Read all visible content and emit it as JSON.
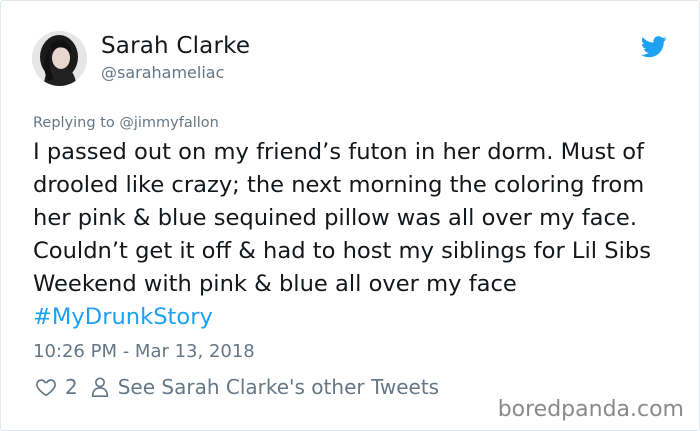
{
  "tweet": {
    "display_name": "Sarah Clarke",
    "handle": "@sarahameliac",
    "replying_prefix": "Replying to",
    "replying_to": "@jimmyfallon",
    "text": "I passed out on my friend’s futon in her dorm. Must of drooled like crazy; the next morning the coloring from her pink & blue sequined pillow was all over my face. Couldn’t get it off & had to host my siblings for Lil Sibs Weekend with pink & blue all over my face",
    "hashtag": "#MyDrunkStory",
    "timestamp": "10:26 PM - Mar 13, 2018",
    "like_count": "2",
    "other_tweets_link": "See Sarah Clarke's other Tweets"
  },
  "watermark": "boredpanda.com",
  "colors": {
    "accent": "#1da1f2",
    "text": "#14171a",
    "muted": "#657786",
    "border": "#e1e8ed"
  },
  "icons": {
    "platform": "twitter-bird-icon",
    "like": "heart-icon",
    "profile": "person-icon"
  }
}
